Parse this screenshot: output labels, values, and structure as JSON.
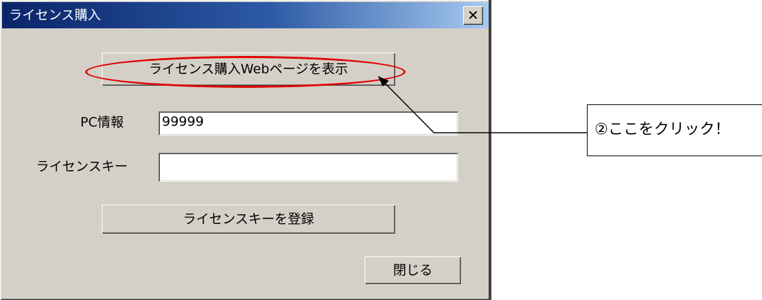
{
  "dialog": {
    "title": "ライセンス購入",
    "close_glyph": "✕",
    "web_button_label": "ライセンス購入Webページを表示",
    "pc_info_label": "PC情報",
    "pc_info_value": "99999",
    "license_key_label": "ライセンスキー",
    "license_key_value": "",
    "register_button_label": "ライセンスキーを登録",
    "close_button_label": "閉じる"
  },
  "annotation": {
    "callout_text": "②ここをクリック！",
    "highlight_color": "#e00000"
  },
  "colors": {
    "titlebar_start": "#0a246a",
    "titlebar_end": "#a6caf0",
    "dialog_bg": "#d4d0c8"
  },
  "icons": {
    "close": "close-icon"
  }
}
